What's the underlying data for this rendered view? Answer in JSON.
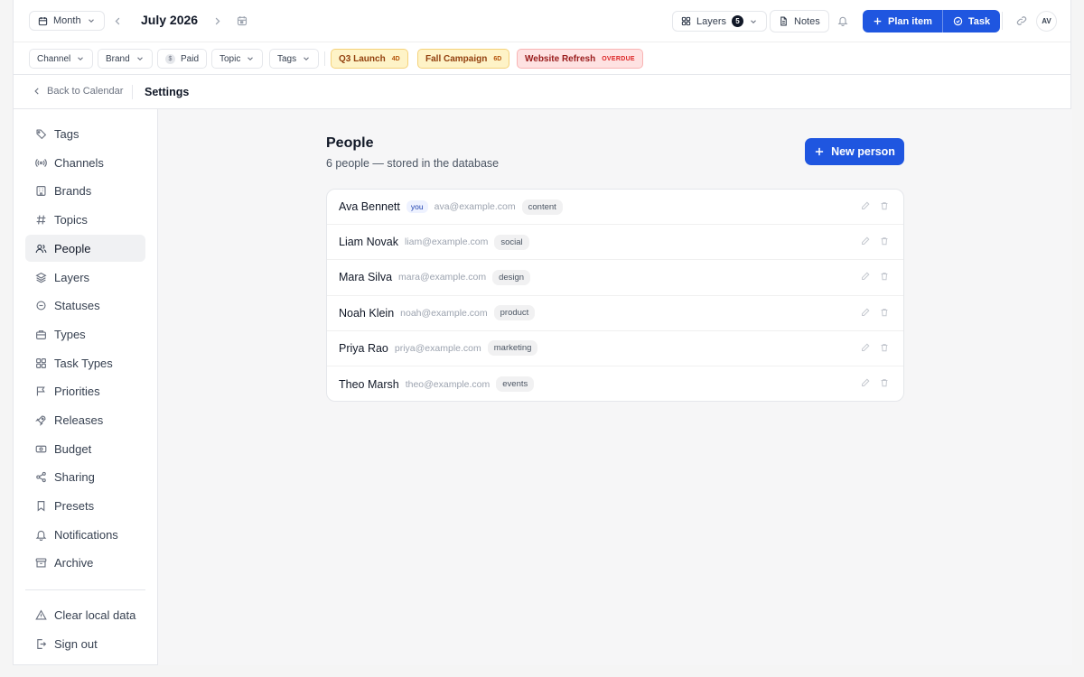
{
  "colors": {
    "accent": "#1f56e0",
    "overdue": "#dc2626",
    "warning": "#f5d27a"
  },
  "topbar": {
    "view_select": {
      "label": "Month",
      "icon": "calendar-icon"
    },
    "current_period": "July 2026",
    "layers": {
      "label": "Layers",
      "count": "5"
    },
    "notes_label": "Notes",
    "plan_item_label": "Plan item",
    "task_label": "Task",
    "avatar_initials": "AV"
  },
  "filters": {
    "channel": "Channel",
    "brand": "Brand",
    "paid": "Paid",
    "paid_symbol": "$",
    "topic": "Topic",
    "tags": "Tags"
  },
  "campaigns": [
    {
      "label": "Q3 Launch",
      "tag": "4D"
    },
    {
      "label": "Fall Campaign",
      "tag": "6D"
    },
    {
      "label": "Website Refresh",
      "tag": "OVERDUE"
    }
  ],
  "settings": {
    "back_label": "Back to Calendar",
    "title": "Settings"
  },
  "sidebar": {
    "items": [
      {
        "label": "Tags",
        "icon": "tag-icon"
      },
      {
        "label": "Channels",
        "icon": "broadcast-icon"
      },
      {
        "label": "Brands",
        "icon": "building-icon"
      },
      {
        "label": "Topics",
        "icon": "hash-icon"
      },
      {
        "label": "People",
        "icon": "users-icon",
        "active": true
      },
      {
        "label": "Layers",
        "icon": "layers-icon"
      },
      {
        "label": "Statuses",
        "icon": "status-circle-icon"
      },
      {
        "label": "Types",
        "icon": "briefcase-icon"
      },
      {
        "label": "Task Types",
        "icon": "grid-icon"
      },
      {
        "label": "Priorities",
        "icon": "flag-icon"
      },
      {
        "label": "Releases",
        "icon": "rocket-icon"
      },
      {
        "label": "Budget",
        "icon": "banknote-icon"
      },
      {
        "label": "Sharing",
        "icon": "share-icon"
      },
      {
        "label": "Presets",
        "icon": "bookmark-icon"
      },
      {
        "label": "Notifications",
        "icon": "bell-icon"
      },
      {
        "label": "Archive",
        "icon": "archive-icon"
      }
    ],
    "bottom": [
      {
        "label": "Clear local data",
        "icon": "warning-icon"
      },
      {
        "label": "Sign out",
        "icon": "sign-out-icon"
      }
    ]
  },
  "people_page": {
    "title": "People",
    "subtitle": "6 people — stored in the database",
    "new_button": "New person",
    "you_badge": "you",
    "people": [
      {
        "name": "Ava Bennett",
        "email": "ava@example.com",
        "role": "content",
        "is_you": true
      },
      {
        "name": "Liam Novak",
        "email": "liam@example.com",
        "role": "social"
      },
      {
        "name": "Mara Silva",
        "email": "mara@example.com",
        "role": "design"
      },
      {
        "name": "Noah Klein",
        "email": "noah@example.com",
        "role": "product"
      },
      {
        "name": "Priya Rao",
        "email": "priya@example.com",
        "role": "marketing"
      },
      {
        "name": "Theo Marsh",
        "email": "theo@example.com",
        "role": "events"
      }
    ]
  }
}
